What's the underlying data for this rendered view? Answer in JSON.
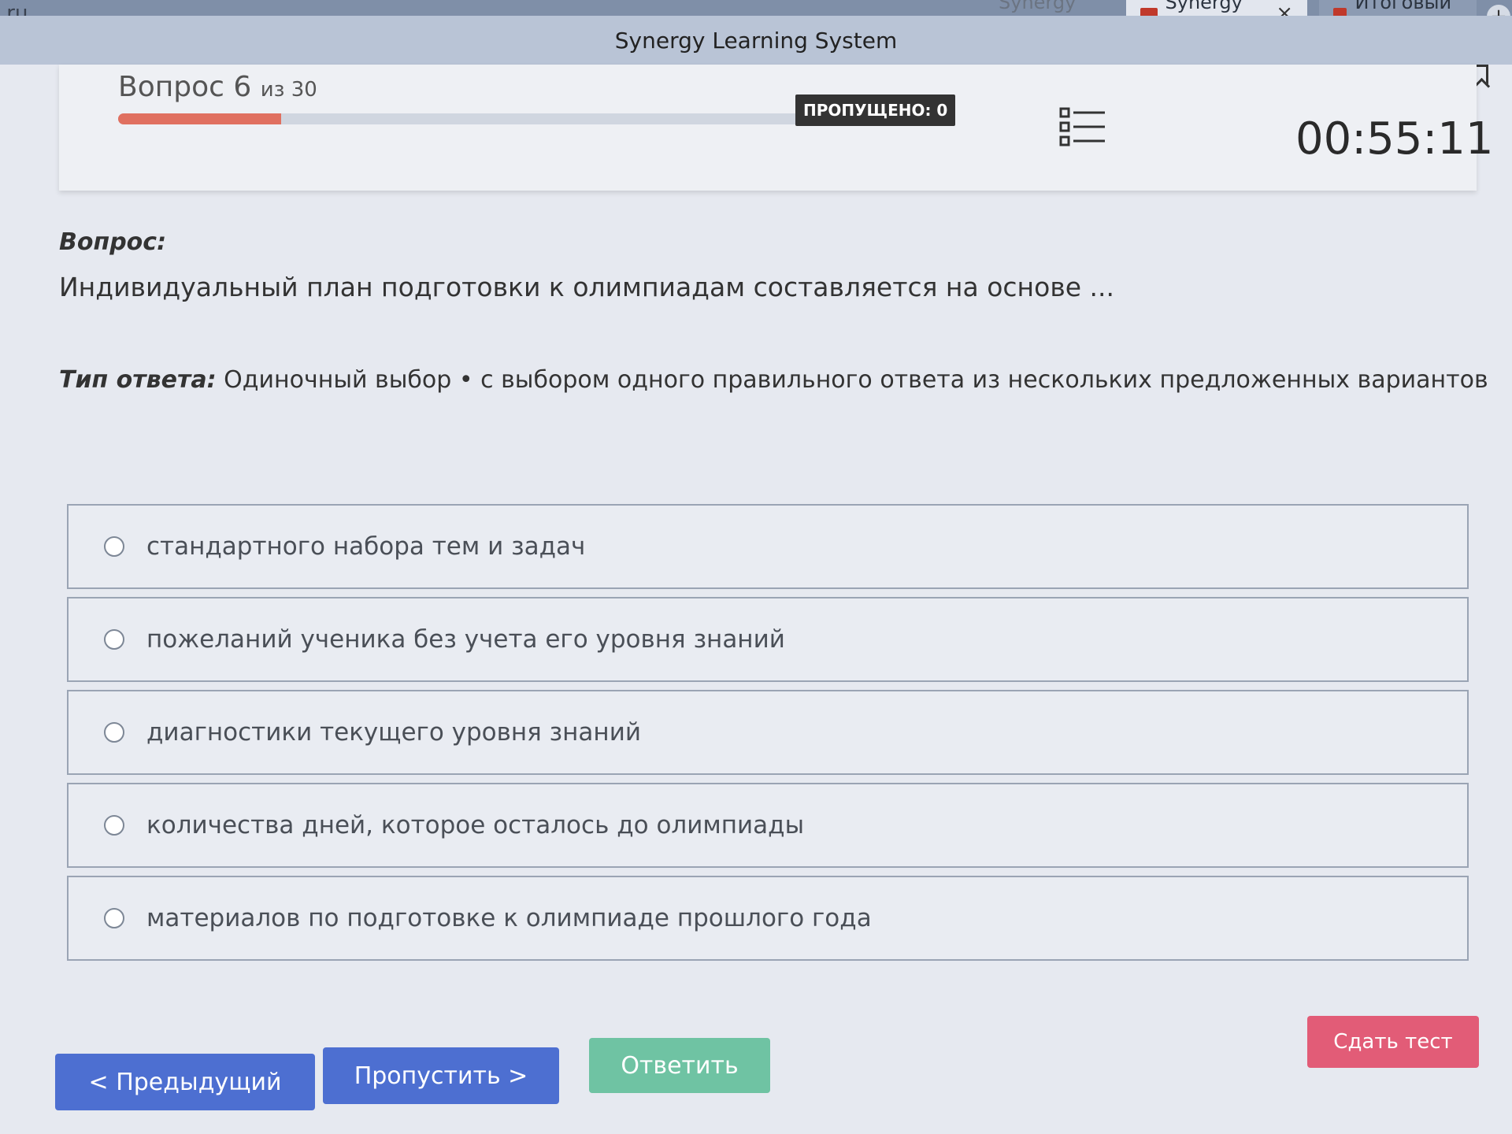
{
  "browser": {
    "url_fragment": ".ru",
    "tabs": [
      {
        "label": "Synergy Lean"
      },
      {
        "label": "Synergy Le",
        "close": "×"
      },
      {
        "label": "Итоговый тес"
      }
    ],
    "new_tab": "+",
    "window_title": "Synergy Learning System",
    "menu_dots": "···"
  },
  "header": {
    "question_label": "Вопрос 6",
    "question_of": "из 30",
    "progress_fraction": 0.2,
    "skipped_badge": "ПРОПУЩЕНО: 0",
    "timer": "00:55:11"
  },
  "question": {
    "label": "Вопрос:",
    "text": "Индивидуальный план подготовки к олимпиадам составляется на основе ...",
    "answer_type_label": "Тип ответа:",
    "answer_type_text": "Одиночный выбор • с выбором одного правильного ответа из нескольких предложенных вариантов"
  },
  "options": [
    {
      "text": "стандартного набора тем и задач"
    },
    {
      "text": "пожеланий ученика без учета его уровня знаний"
    },
    {
      "text": "диагностики текущего уровня знаний"
    },
    {
      "text": "количества дней, которое осталось до олимпиады"
    },
    {
      "text": "материалов по подготовке к олимпиаде прошлого года"
    }
  ],
  "buttons": {
    "prev": "< Предыдущий",
    "skip": "Пропустить >",
    "answer": "Ответить",
    "submit": "Сдать тест"
  }
}
